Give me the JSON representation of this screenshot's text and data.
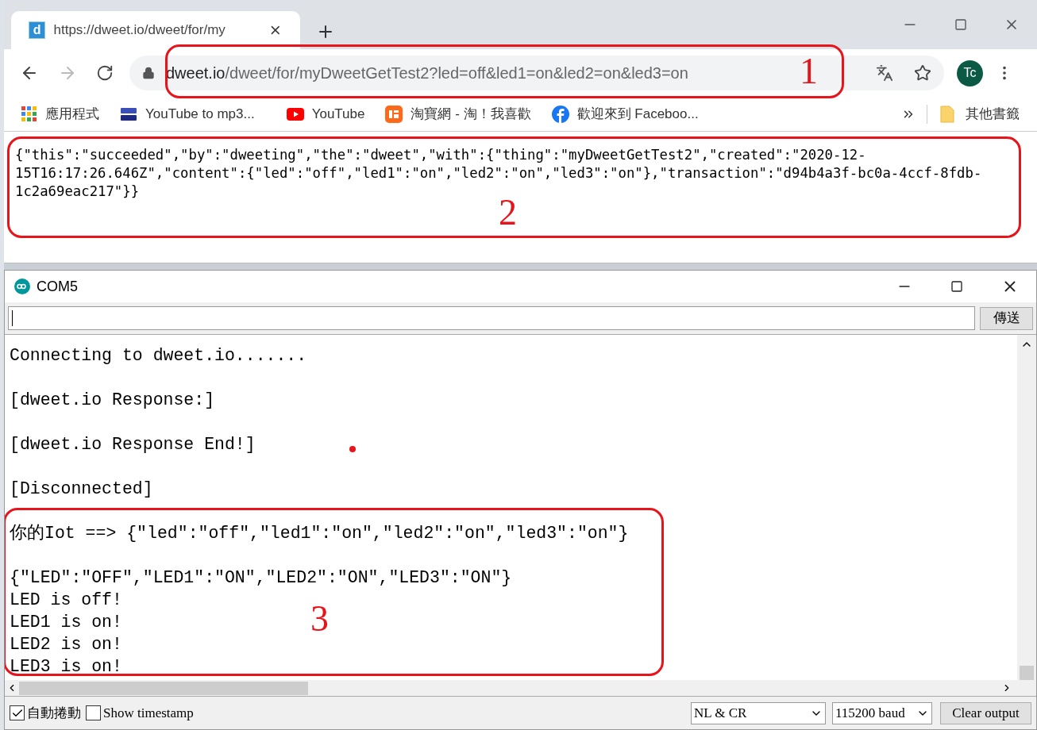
{
  "browser": {
    "tab": {
      "favicon_letter": "d",
      "title": "https://dweet.io/dweet/for/my"
    },
    "address": {
      "host": "dweet.io",
      "path": "/dweet/for/myDweetGetTest2?led=off&led1=on&led2=on&led3=on"
    },
    "nav": {
      "forward_disabled": true
    },
    "avatar": "Tc",
    "bookmarks": [
      {
        "kind": "apps",
        "label": "應用程式"
      },
      {
        "kind": "ytmp3",
        "label": "YouTube to mp3..."
      },
      {
        "kind": "youtube",
        "label": "YouTube"
      },
      {
        "kind": "taobao",
        "label": "淘寶網 - 淘！我喜歡"
      },
      {
        "kind": "facebook",
        "label": "歡迎來到 Faceboo..."
      }
    ],
    "other_bookmarks": "其他書籤",
    "page_lines": [
      "{\"this\":\"succeeded\",\"by\":\"dweeting\",\"the\":\"dweet\",\"with\":{\"thing\":\"myDweetGetTest2\",\"created\":\"2020-12-",
      "15T16:17:26.646Z\",\"content\":{\"led\":\"off\",\"led1\":\"on\",\"led2\":\"on\",\"led3\":\"on\"},\"transaction\":\"d94b4a3f-bc0a-4ccf-8fdb-",
      "1c2a69eac217\"}}"
    ]
  },
  "serial": {
    "title": "COM5",
    "send": "傳送",
    "output": [
      {
        "lines": [
          "Connecting to dweet.io......."
        ]
      },
      {
        "lines": [
          "[dweet.io Response:]"
        ]
      },
      {
        "lines": [
          "[dweet.io Response End!]"
        ]
      },
      {
        "lines": [
          "[Disconnected]"
        ]
      }
    ],
    "highlighted_output": [
      {
        "lines": [
          "你的Iot ==> {\"led\":\"off\",\"led1\":\"on\",\"led2\":\"on\",\"led3\":\"on\"}"
        ]
      },
      {
        "lines": [
          "{\"LED\":\"OFF\",\"LED1\":\"ON\",\"LED2\":\"ON\",\"LED3\":\"ON\"}",
          "LED is off!",
          "LED1 is on!",
          "LED2 is on!",
          "LED3 is on!"
        ]
      }
    ],
    "autoscroll": {
      "label": "自動捲動",
      "checked": true
    },
    "timestamp": {
      "label": "Show timestamp",
      "checked": false
    },
    "line_ending": "NL & CR",
    "baud": "115200 baud",
    "clear": "Clear output"
  },
  "annotations": [
    {
      "label": "1"
    },
    {
      "label": "2"
    },
    {
      "label": "3"
    }
  ]
}
